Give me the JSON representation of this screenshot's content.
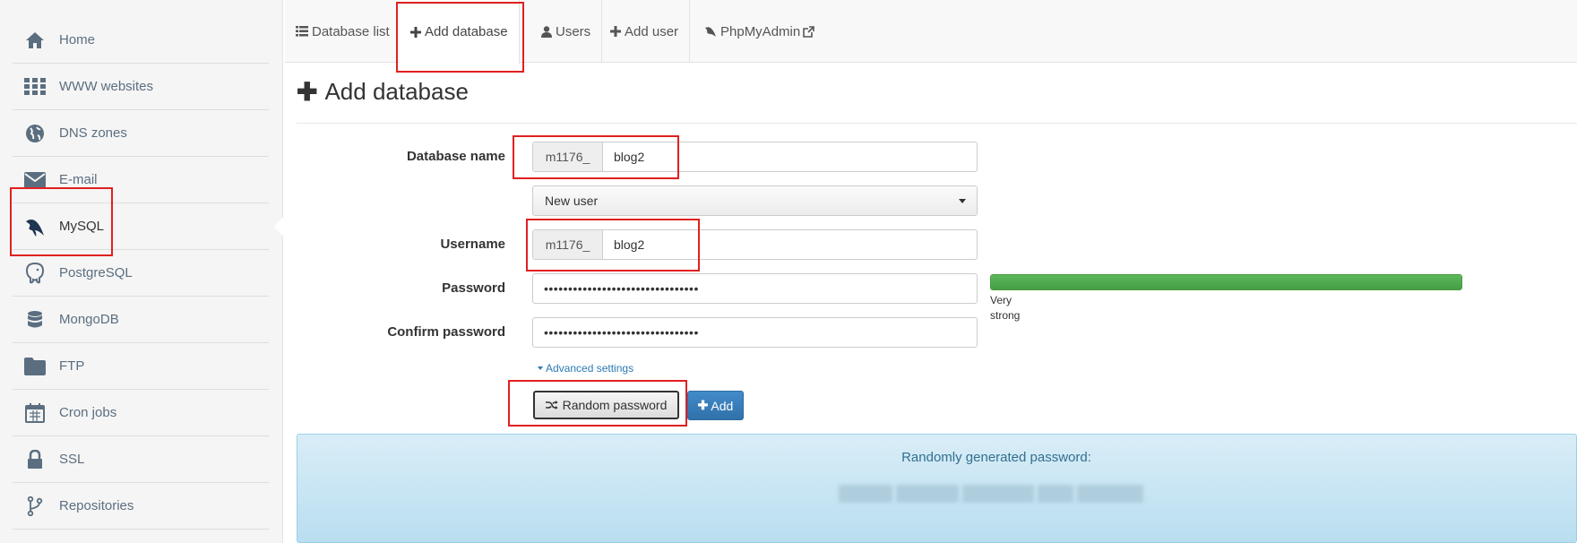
{
  "sidebar": {
    "items": [
      {
        "label": "Home",
        "icon": "home-icon"
      },
      {
        "label": "WWW websites",
        "icon": "grid-icon"
      },
      {
        "label": "DNS zones",
        "icon": "globe-icon"
      },
      {
        "label": "E-mail",
        "icon": "envelope-icon"
      },
      {
        "label": "MySQL",
        "icon": "mysql-dolphin-icon"
      },
      {
        "label": "PostgreSQL",
        "icon": "postgresql-elephant-icon"
      },
      {
        "label": "MongoDB",
        "icon": "database-icon"
      },
      {
        "label": "FTP",
        "icon": "folder-icon"
      },
      {
        "label": "Cron jobs",
        "icon": "calendar-icon"
      },
      {
        "label": "SSL",
        "icon": "lock-icon"
      },
      {
        "label": "Repositories",
        "icon": "git-branch-icon"
      }
    ],
    "active": "MySQL"
  },
  "tabs": [
    {
      "label": "Database list",
      "icon": "list-icon"
    },
    {
      "label": "Add database",
      "icon": "plus-icon"
    },
    {
      "label": "Users",
      "icon": "user-icon"
    },
    {
      "label": "Add user",
      "icon": "plus-icon"
    },
    {
      "label": "PhpMyAdmin",
      "icon": "phpmyadmin-icon",
      "trailing_icon": "external-link-icon"
    }
  ],
  "active_tab": "Add database",
  "page": {
    "title": "Add database"
  },
  "form": {
    "database_name": {
      "label": "Database name",
      "prefix": "m1176_",
      "value": "blog2"
    },
    "user_select": {
      "value": "New user"
    },
    "username": {
      "label": "Username",
      "prefix": "m1176_",
      "value": "blog2"
    },
    "password": {
      "label": "Password",
      "value": "••••••••••••••••••••••••••••••••"
    },
    "confirm_password": {
      "label": "Confirm password",
      "value": "••••••••••••••••••••••••••••••••"
    },
    "strength": {
      "text_line1": "Very",
      "text_line2": "strong",
      "level": 1.0,
      "color": "#5cb85c"
    },
    "advanced_settings": "Advanced settings",
    "random_password_button": "Random password",
    "add_button": "Add"
  },
  "generated": {
    "title": "Randomly generated password:"
  },
  "colors": {
    "accent": "#428bca",
    "link": "#2a7ab5",
    "highlight": "#e02020",
    "info_bg": "#d9edf7"
  }
}
